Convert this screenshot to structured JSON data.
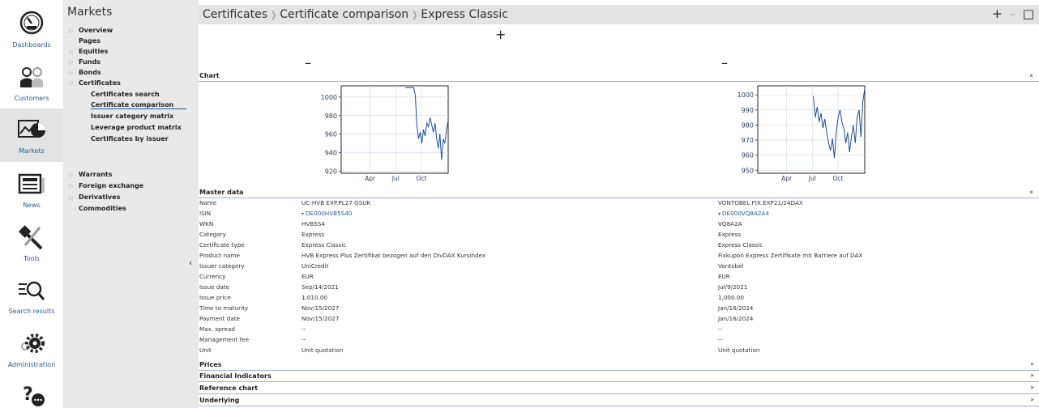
{
  "rail": [
    {
      "label": "Dashboards",
      "icon": "dashboard-gauge-icon"
    },
    {
      "label": "Customers",
      "icon": "customers-icon"
    },
    {
      "label": "Markets",
      "icon": "markets-chart-icon"
    },
    {
      "label": "News",
      "icon": "news-icon"
    },
    {
      "label": "Tools",
      "icon": "tools-icon"
    },
    {
      "label": "Search results",
      "icon": "search-results-icon"
    },
    {
      "label": "Administration",
      "icon": "gear-icon"
    },
    {
      "label": "",
      "icon": "help-chat-icon"
    }
  ],
  "nav": {
    "title": "Markets",
    "items": [
      "Overview",
      "Pages",
      "Equities",
      "Funds",
      "Bonds",
      "Certificates"
    ],
    "cert_sub": [
      "Certificates search",
      "Certificate comparison",
      "Issuer category matrix",
      "Leverage product matrix",
      "Certificates by issuer"
    ],
    "items2": [
      "Warrants",
      "Foreign exchange",
      "Derivatives",
      "Commodities"
    ]
  },
  "header": {
    "crumb1": "Certificates",
    "crumb2": "Certificate comparison",
    "crumb3": "Express Classic",
    "add": "+",
    "minimize": "–",
    "window": "□"
  },
  "content": {
    "plus": "+",
    "minus1": "–",
    "minus2": "–"
  },
  "sections": {
    "chart": "Chart",
    "master": "Master data",
    "prices": "Prices",
    "financial": "Financial Indicators",
    "reference": "Reference chart",
    "underlying": "Underlying"
  },
  "chart_data": [
    {
      "type": "line",
      "title": "",
      "x_ticks": [
        "Apr",
        "Jul",
        "Oct"
      ],
      "y_ticks": [
        920,
        940,
        960,
        980,
        1000
      ],
      "ylim": [
        918,
        1012
      ],
      "series": [
        {
          "values": [
            1010,
            1010,
            1010,
            1010,
            1010,
            1010,
            1002,
            970,
            955,
            962,
            950,
            965,
            958,
            972,
            968,
            978,
            970,
            962,
            972,
            955,
            945,
            960,
            932,
            955,
            950,
            965,
            975
          ]
        }
      ]
    },
    {
      "type": "line",
      "title": "",
      "x_ticks": [
        "Apr",
        "Jul",
        "Oct"
      ],
      "y_ticks": [
        950,
        960,
        970,
        980,
        990,
        1000
      ],
      "ylim": [
        948,
        1006
      ],
      "series": [
        {
          "values": [
            999,
            985,
            992,
            982,
            988,
            978,
            984,
            975,
            968,
            963,
            971,
            958,
            975,
            985,
            990,
            982,
            978,
            968,
            975,
            962,
            972,
            980,
            968,
            985,
            990,
            972,
            996,
            1004
          ]
        }
      ]
    }
  ],
  "master": {
    "rows": [
      {
        "label": "Name",
        "a": "UC-HVB EXP.PL27 GSUK",
        "b": "VONTOBEL FIX.EXP21/24DAX"
      },
      {
        "label": "ISIN",
        "a": "DE000HVB5S40",
        "b": "DE000VQ8A2A4",
        "link": true
      },
      {
        "label": "WKN",
        "a": "HVB5S4",
        "b": "VQ8A2A"
      },
      {
        "label": "Category",
        "a": "Express",
        "b": "Express"
      },
      {
        "label": "Certificate type",
        "a": "Express Classic",
        "b": "Express Classic"
      },
      {
        "label": "Product name",
        "a": "HVB Express Plus Zertifikat bezogen auf den DivDAX Kursindex",
        "b": "Fixkupon Express Zertifikate mit Barriere auf DAX"
      },
      {
        "label": "Issuer category",
        "a": "UniCredit",
        "b": "Vontobel"
      },
      {
        "label": "Currency",
        "a": "EUR",
        "b": "EUR"
      },
      {
        "label": "Issue date",
        "a": "Sep/14/2021",
        "b": "Jul/9/2021"
      },
      {
        "label": "Issue price",
        "a": "1,010.00",
        "b": "1,000.00"
      },
      {
        "label": "Time to maturity",
        "a": "Nov/15/2027",
        "b": "Jan/16/2024"
      },
      {
        "label": "Payment date",
        "a": "Nov/15/2027",
        "b": "Jan/16/2024"
      },
      {
        "label": "Max. spread",
        "a": "--",
        "b": "--"
      },
      {
        "label": "Management fee",
        "a": "--",
        "b": "--"
      },
      {
        "label": "Unit",
        "a": "Unit quotation",
        "b": "Unit quotation"
      }
    ]
  }
}
